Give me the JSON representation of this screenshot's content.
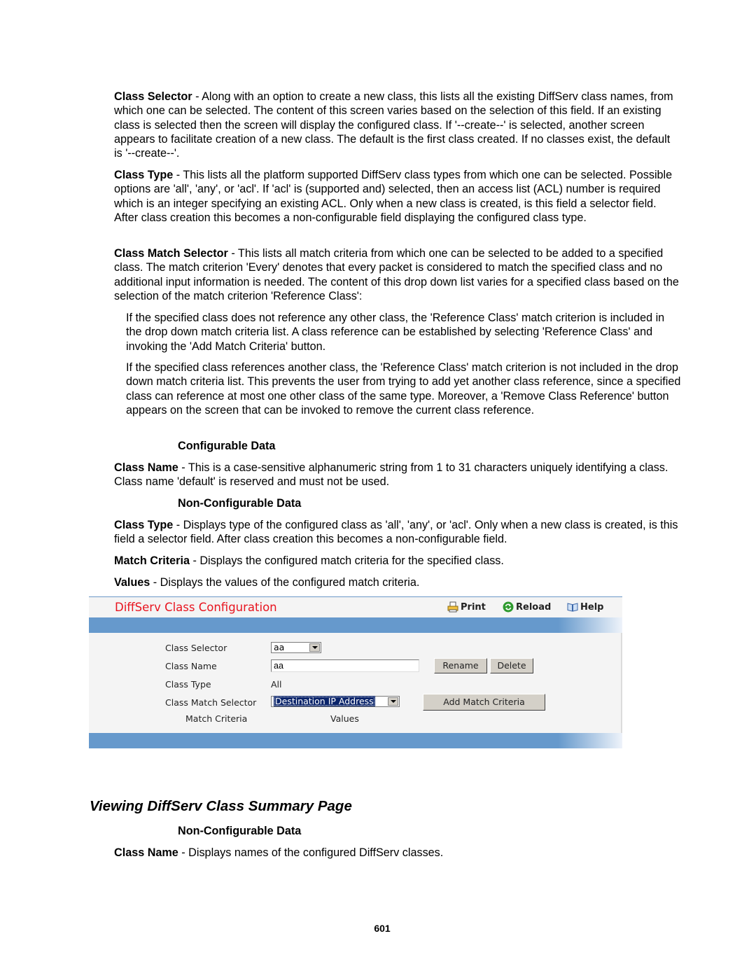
{
  "doc": {
    "para_class_selector": {
      "term": "Class Selector",
      "text": " - Along with an option to create a new class, this lists all the existing DiffServ class names, from which one can be selected. The content of this screen varies based on the selection of this field. If an existing class is selected then the screen will display the configured class. If '--create--' is selected, another screen appears to facilitate creation of a new class. The default is the first class created. If no classes exist, the default is '--create--'."
    },
    "para_class_type": {
      "term": "Class Type",
      "text": " - This lists all the platform supported DiffServ class types from which one can be selected. Possible options are 'all', 'any', or 'acl'. If 'acl' is (supported and) selected, then an access list (ACL) number is required which is an integer specifying an existing ACL. Only when a new class is created, is this field a selector field. After class creation this becomes a non-configurable field displaying the configured class type."
    },
    "para_class_match_selector": {
      "term": "Class Match Selector",
      "text": " - This lists all match criteria from which one can be selected to be added to a specified class. The match criterion 'Every' denotes that every packet is considered to match the specified class and no additional input information is needed. The content of this drop down list varies for a specified class based on the selection of the match criterion 'Reference Class':"
    },
    "indent_1": "If the specified class does not reference any other class, the 'Reference Class' match criterion is included in the drop down match criteria list. A class reference can be established by selecting 'Reference Class' and invoking the 'Add Match Criteria' button.",
    "indent_2": "If the specified class references another class, the 'Reference Class' match criterion is not included in the drop down match criteria list. This prevents the user from trying to add yet another class reference, since a specified class can reference at most one other class of the same type. Moreover, a 'Remove Class Reference' button appears on the screen that can be invoked to remove the current class reference.",
    "subhead_configurable": "Configurable Data",
    "para_class_name": {
      "term": "Class Name",
      "text": " - This is a case-sensitive alphanumeric string from 1 to 31 characters uniquely identifying a class. Class name 'default' is reserved and must not be used."
    },
    "subhead_nonconfigurable": "Non-Configurable Data",
    "para_class_type_nc": {
      "term": "Class Type",
      "text": " - Displays type of the configured class as 'all', 'any', or 'acl'. Only when a new class is created, is this field a selector field. After class creation this becomes a non-configurable field."
    },
    "para_match_criteria": {
      "term": "Match Criteria",
      "text": " - Displays the configured match criteria for the specified class."
    },
    "para_values": {
      "term": "Values",
      "text": " - Displays the values of the configured match criteria."
    },
    "section_title": "Viewing DiffServ Class Summary Page",
    "subhead_nonconfigurable_2": "Non-Configurable Data",
    "para_summary_class_name": {
      "term": "Class Name",
      "text": " - Displays names of the configured DiffServ classes."
    },
    "page_number": "601"
  },
  "ui": {
    "title": "DiffServ Class Configuration",
    "title_color": "#e8141f",
    "band_color": "#6699cc",
    "toolbar": {
      "print": "Print",
      "reload": "Reload",
      "help": "Help"
    },
    "form": {
      "class_selector_label": "Class Selector",
      "class_selector_value": "aa",
      "class_name_label": "Class Name",
      "class_name_value": "aa",
      "rename_button": "Rename",
      "delete_button": "Delete",
      "class_type_label": "Class Type",
      "class_type_value": "All",
      "class_match_selector_label": "Class Match Selector",
      "class_match_selector_value": "Destination IP Address",
      "add_match_criteria_button": "Add Match Criteria",
      "col_match_criteria": "Match Criteria",
      "col_values": "Values"
    }
  }
}
